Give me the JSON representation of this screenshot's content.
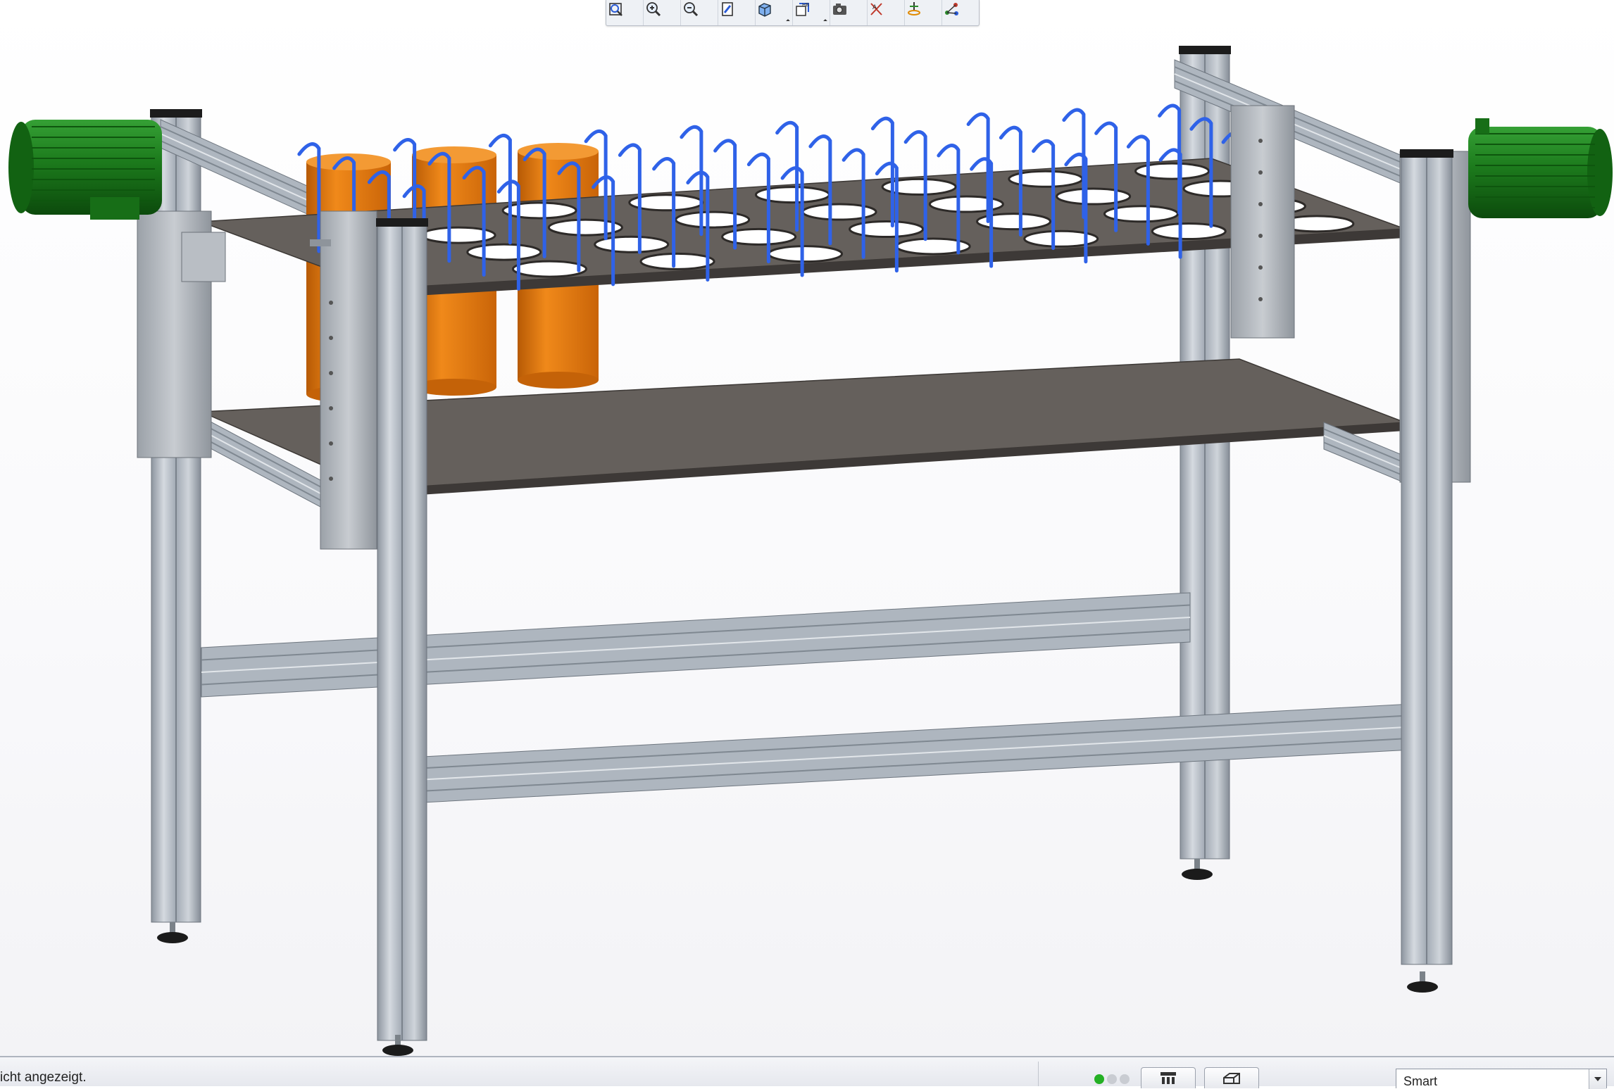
{
  "toolbar": {
    "buttons": [
      {
        "icon": "refit-icon"
      },
      {
        "icon": "zoom-in-icon"
      },
      {
        "icon": "zoom-out-icon"
      },
      {
        "icon": "repaint-icon"
      },
      {
        "icon": "display-style-icon",
        "dropdown": true
      },
      {
        "icon": "saved-orientations-icon",
        "dropdown": true
      },
      {
        "icon": "named-views-icon"
      },
      {
        "icon": "annotation-display-icon"
      },
      {
        "icon": "spin-center-icon"
      },
      {
        "icon": "datum-display-icon"
      }
    ]
  },
  "model": {
    "frame_color": "#aab2bc",
    "plate_color": "#65605c",
    "motor_color": "#1f7a1f",
    "tube_color": "#e07a10",
    "hook_color": "#2f62e8"
  },
  "status": {
    "message": "icht angezeigt.",
    "lights": [
      "#24b024",
      "#c9ccd2",
      "#c9ccd2"
    ],
    "model_tree_icon": "model-tree-icon",
    "view_manager_icon": "view-manager-icon",
    "filter_value": "Smart"
  }
}
